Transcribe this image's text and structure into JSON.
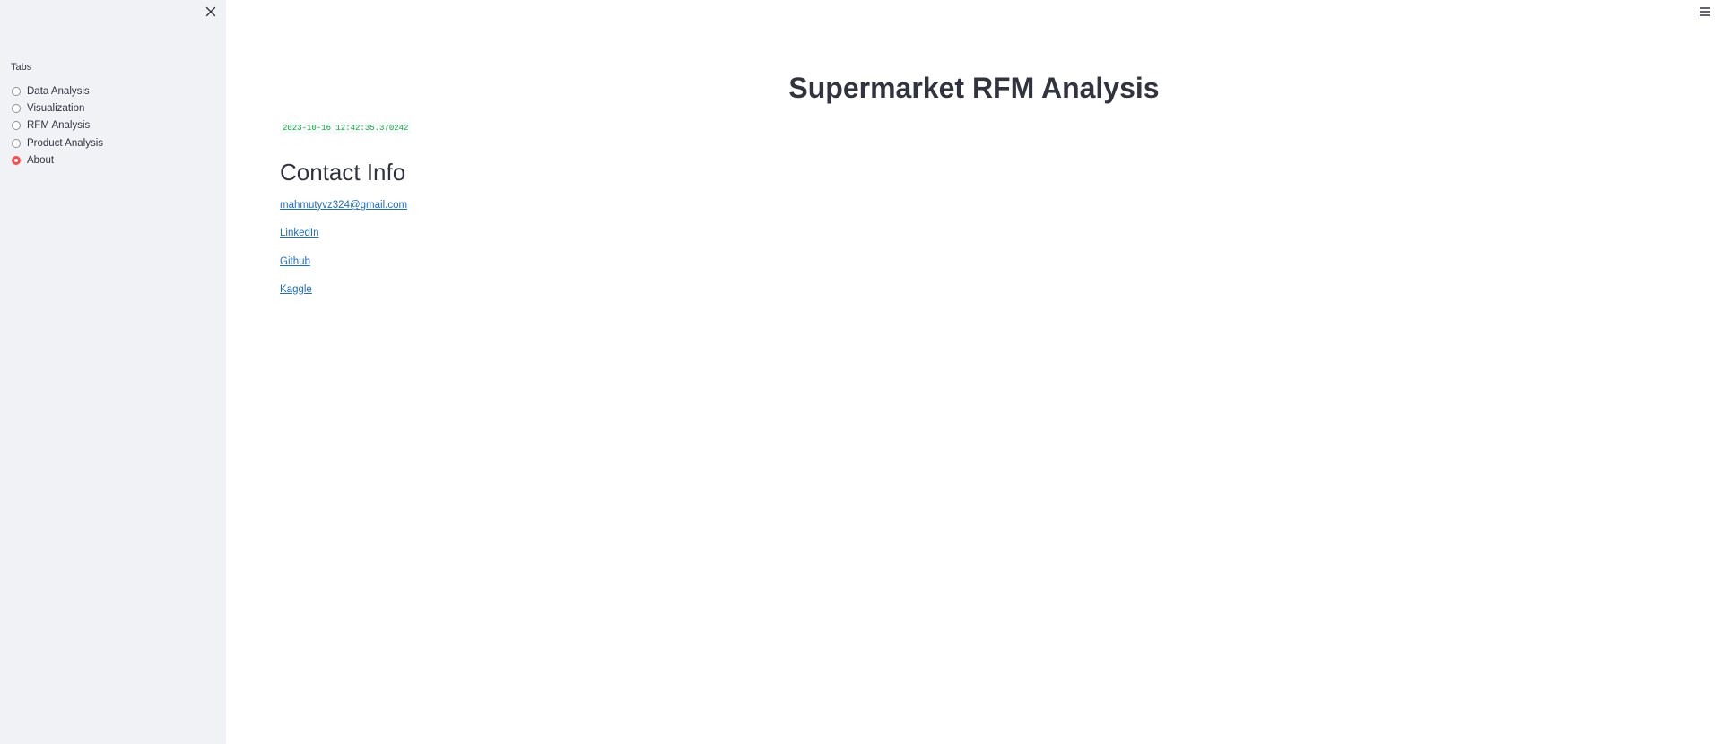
{
  "sidebar": {
    "group_label": "Tabs",
    "options": [
      {
        "label": "Data Analysis",
        "selected": false
      },
      {
        "label": "Visualization",
        "selected": false
      },
      {
        "label": "RFM Analysis",
        "selected": false
      },
      {
        "label": "Product Analysis",
        "selected": false
      },
      {
        "label": "About",
        "selected": true
      }
    ],
    "close_icon": "close-icon"
  },
  "header": {
    "menu_icon": "hamburger-menu-icon"
  },
  "main": {
    "title": "Supermarket RFM Analysis",
    "timestamp": "2023-10-16 12:42:35.370242",
    "contact_heading": "Contact Info",
    "links": [
      {
        "label": "mahmutyvz324@gmail.com"
      },
      {
        "label": "LinkedIn"
      },
      {
        "label": "Github"
      },
      {
        "label": "Kaggle"
      }
    ]
  },
  "colors": {
    "accent": "#ff4b4b",
    "link": "#1c6bc7",
    "timestamp": "#09ab3b",
    "sidebar_bg": "#f0f2f6",
    "text": "#31333f"
  }
}
